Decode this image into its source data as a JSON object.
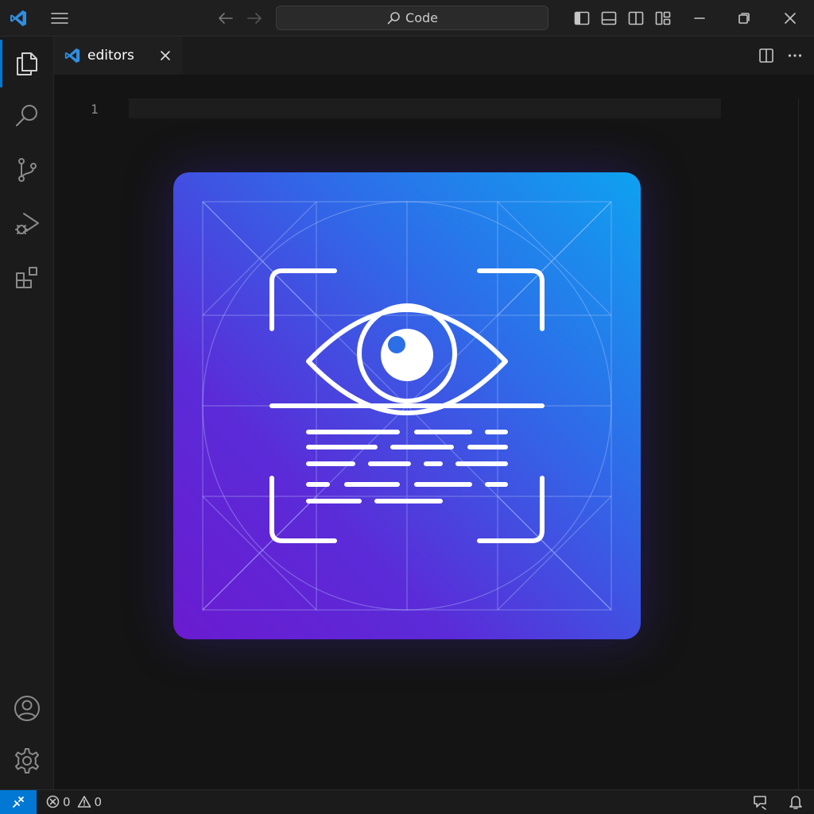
{
  "titlebar": {
    "search_text": "Code",
    "icons": [
      "vscode-logo",
      "menu-icon",
      "arrow-left-icon",
      "arrow-right-icon",
      "search-icon",
      "toggle-primary-sidebar-icon",
      "toggle-panel-icon",
      "toggle-secondary-sidebar-icon",
      "customize-layout-icon",
      "minimize-icon",
      "restore-icon",
      "close-icon"
    ]
  },
  "activitybar": {
    "items": [
      "explorer-icon",
      "search-icon",
      "source-control-icon",
      "run-debug-icon",
      "extensions-icon"
    ],
    "bottom": [
      "accounts-icon",
      "manage-gear-icon"
    ]
  },
  "tabs": [
    {
      "label": "editors",
      "active": true
    }
  ],
  "editor": {
    "line_numbers": [
      "1"
    ],
    "image_description_icons": [
      "eye-icon",
      "scan-frame-icon",
      "text-lines-icon"
    ]
  },
  "statusbar": {
    "errors": "0",
    "warnings": "0",
    "icons": [
      "remote-icon",
      "error-icon",
      "warning-icon",
      "feedback-icon",
      "bell-icon"
    ]
  },
  "colors": {
    "accent": "#0078d4",
    "gradient_top_right": "#0ea2f0",
    "gradient_bottom_left": "#6a1bd0"
  }
}
